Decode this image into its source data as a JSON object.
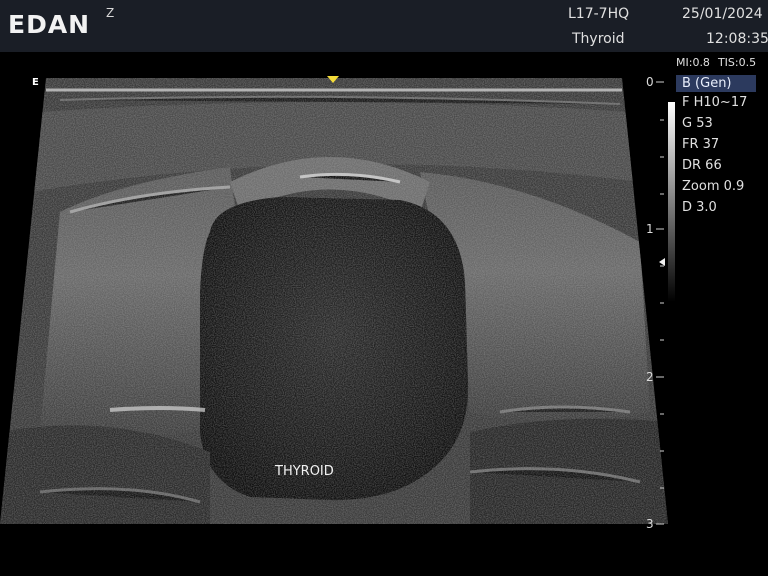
{
  "header": {
    "brand": "EDAN",
    "zoom_flag": "Z",
    "probe": "L17-7HQ",
    "preset": "Thyroid",
    "date": "25/01/2024",
    "time": "12:08:35"
  },
  "image": {
    "orientation_marker": "E",
    "annotation": "THYROID"
  },
  "safety": {
    "mi": "MI:0.8",
    "tis": "TIS:0.5"
  },
  "params": {
    "mode": "B (Gen)",
    "frequency": "F H10~17",
    "gain": "G 53",
    "frame_rate": "FR 37",
    "dynamic_range": "DR 66",
    "zoom": "Zoom 0.9",
    "depth": "D 3.0"
  },
  "depth_scale": {
    "labels": [
      "0",
      "1",
      "2",
      "3"
    ]
  },
  "colors": {
    "header_bg": "#1a1e26",
    "mode_highlight": "#2c3a5e",
    "center_marker": "#f4dc3a"
  }
}
